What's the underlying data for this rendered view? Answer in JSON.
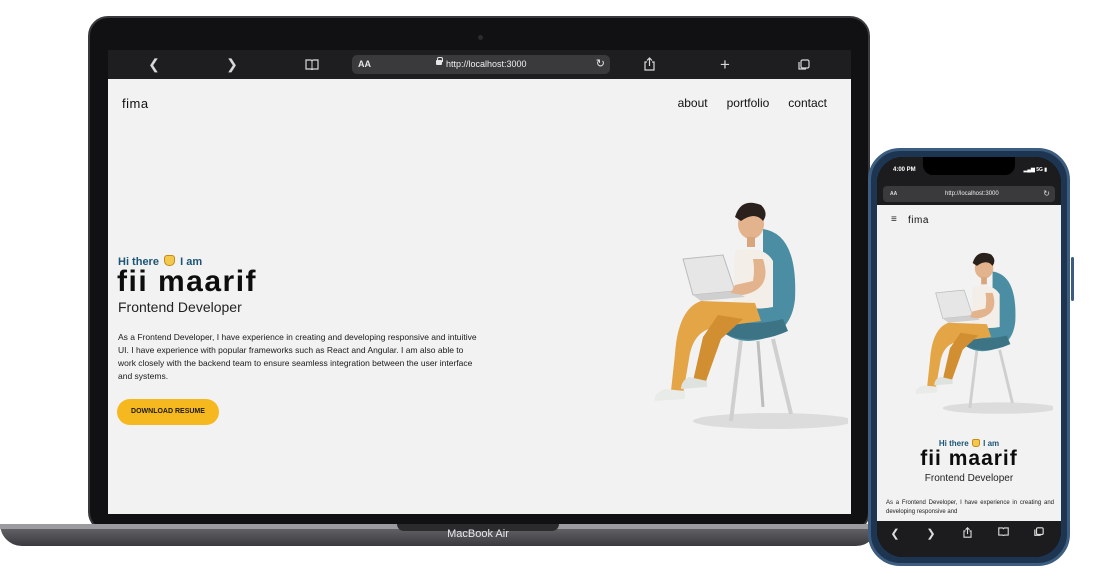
{
  "mac": {
    "label": "MacBook Air",
    "browser": {
      "back_icon": "chevron-left-icon",
      "forward_icon": "chevron-right-icon",
      "bookmarks_icon": "book-icon",
      "text_size": "AA",
      "url": "http://localhost:3000",
      "reload_icon": "reload-icon",
      "share_icon": "share-icon",
      "new_tab_icon": "plus-icon",
      "tabs_icon": "tabs-icon"
    },
    "site": {
      "brand": "fima",
      "nav": [
        "about",
        "portfolio",
        "contact"
      ],
      "hero": {
        "greeting_pre": "Hi there",
        "greeting_post": "I am",
        "name": "fii maarif",
        "role": "Frontend Developer",
        "description": "As a Frontend Developer, I have experience in creating and developing responsive and intuitive UI. I have experience with popular frameworks such as React and Angular. I am also able to work closely with the backend team to ensure seamless integration between the user interface and systems.",
        "cta": "DOWNLOAD RESUME"
      }
    }
  },
  "phone": {
    "status": {
      "time": "4:00 PM",
      "network": "5G"
    },
    "browser": {
      "text_size": "AA",
      "url": "http://localhost:3000"
    },
    "site": {
      "brand": "fima",
      "greeting_pre": "Hi there",
      "greeting_post": "I am",
      "name": "fii maarif",
      "role": "Frontend Developer",
      "description": "As a Frontend Developer, I have experience in creating and developing responsive and"
    }
  },
  "colors": {
    "accent_blue": "#1c5575",
    "cta_yellow": "#f6b81f",
    "page_bg": "#f2f2f2"
  }
}
